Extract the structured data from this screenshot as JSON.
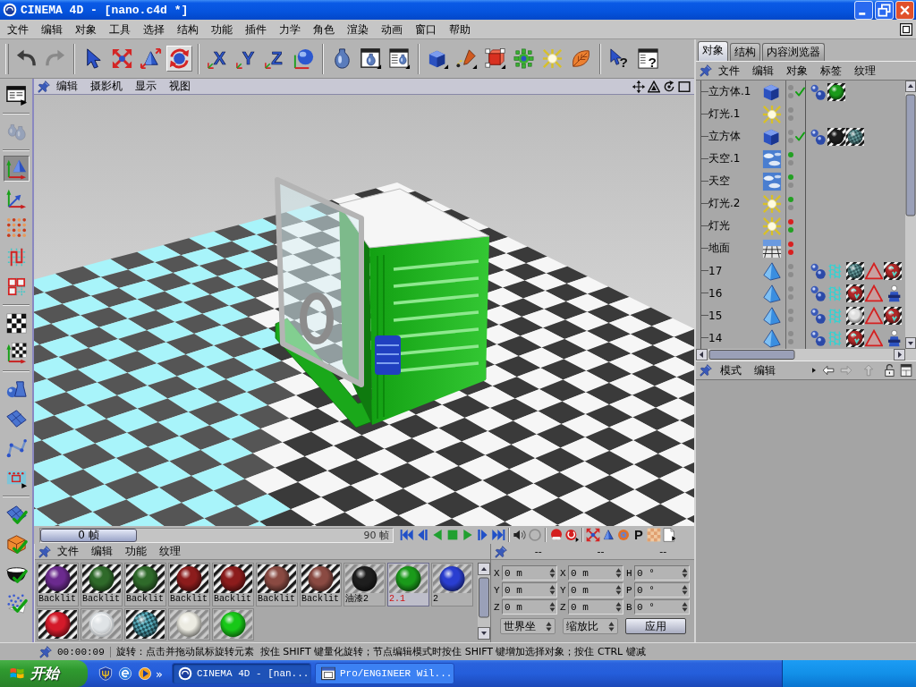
{
  "window": {
    "title": "CINEMA 4D - [nano.c4d *]"
  },
  "menu_bar": [
    "文件",
    "编辑",
    "对象",
    "工具",
    "选择",
    "结构",
    "功能",
    "插件",
    "力学",
    "角色",
    "渲染",
    "动画",
    "窗口",
    "帮助"
  ],
  "toolbar": [
    [
      {
        "kind": "undo",
        "selected": false,
        "disabled": false
      },
      {
        "kind": "redo",
        "selected": false,
        "disabled": true
      }
    ],
    [
      {
        "kind": "select",
        "selected": false,
        "disabled": false
      },
      {
        "kind": "move",
        "selected": false,
        "disabled": false
      },
      {
        "kind": "scale",
        "selected": false,
        "disabled": false
      },
      {
        "kind": "rotate",
        "selected": true,
        "disabled": false
      }
    ],
    [
      {
        "kind": "axis",
        "label": "X",
        "selected": false,
        "disabled": false
      },
      {
        "kind": "axis",
        "label": "Y",
        "selected": false,
        "disabled": false
      },
      {
        "kind": "axis",
        "label": "Z",
        "selected": false,
        "disabled": false
      },
      {
        "kind": "world",
        "selected": false,
        "disabled": false
      }
    ],
    [
      {
        "kind": "render-view",
        "selected": false,
        "disabled": false
      },
      {
        "kind": "render-picture",
        "selected": false,
        "disabled": false
      },
      {
        "kind": "render-settings",
        "selected": false,
        "disabled": false
      }
    ],
    [
      {
        "kind": "cube",
        "selected": false,
        "disabled": false
      },
      {
        "kind": "spline",
        "selected": false,
        "disabled": false
      },
      {
        "kind": "nurbs",
        "selected": false,
        "disabled": false
      },
      {
        "kind": "array",
        "selected": false,
        "disabled": false
      },
      {
        "kind": "light",
        "selected": false,
        "disabled": false
      },
      {
        "kind": "deformer",
        "selected": false,
        "disabled": false
      }
    ],
    [
      {
        "kind": "help-arrow",
        "label": "?",
        "selected": false,
        "disabled": false
      },
      {
        "kind": "help-window",
        "label": "?",
        "selected": false,
        "disabled": false
      }
    ]
  ],
  "left_toolbar": [
    [
      {
        "kind": "layout",
        "selected": false,
        "disabled": false
      }
    ],
    [
      {
        "kind": "vases",
        "selected": false,
        "disabled": true
      }
    ],
    [
      {
        "kind": "model-tool",
        "selected": true,
        "disabled": false
      },
      {
        "kind": "object-axis",
        "selected": false,
        "disabled": false
      },
      {
        "kind": "points",
        "selected": false,
        "disabled": false
      },
      {
        "kind": "edges",
        "selected": false,
        "disabled": false
      },
      {
        "kind": "polygons",
        "selected": false,
        "disabled": false
      }
    ],
    [
      {
        "kind": "texture",
        "selected": false,
        "disabled": false
      },
      {
        "kind": "texture-axis",
        "selected": false,
        "disabled": false
      }
    ],
    [
      {
        "kind": "shapes",
        "selected": false,
        "disabled": false
      },
      {
        "kind": "plane",
        "selected": false,
        "disabled": false
      },
      {
        "kind": "bones",
        "selected": false,
        "disabled": false
      },
      {
        "kind": "animation",
        "selected": false,
        "disabled": false
      }
    ],
    [
      {
        "kind": "plane",
        "selected": false,
        "disabled": false,
        "checked": true
      },
      {
        "kind": "box",
        "selected": false,
        "disabled": false,
        "checked": true
      },
      {
        "kind": "bowl",
        "selected": false,
        "disabled": false,
        "checked": true
      },
      {
        "kind": "particles",
        "selected": false,
        "disabled": false,
        "checked": true
      }
    ]
  ],
  "viewport": {
    "menu": [
      "编辑",
      "摄影机",
      "显示",
      "视图"
    ]
  },
  "timeline": {
    "current": "0 帧",
    "level": 0,
    "end": "90 帧",
    "parameter_key": "P"
  },
  "material_manager": {
    "menu": [
      "文件",
      "编辑",
      "功能",
      "纹理"
    ],
    "materials": [
      {
        "name": "Backlit",
        "color": "#6b2a8e",
        "kind": "solid",
        "dark_backdrop": true,
        "selected": false
      },
      {
        "name": "Backlit",
        "color": "#2f6a2a",
        "kind": "solid",
        "dark_backdrop": true,
        "selected": false
      },
      {
        "name": "Backlit",
        "color": "#2f6a2a",
        "kind": "solid",
        "dark_backdrop": true,
        "selected": false
      },
      {
        "name": "Backlit",
        "color": "#8c1c1c",
        "kind": "solid",
        "dark_backdrop": true,
        "selected": false
      },
      {
        "name": "Backlit",
        "color": "#8c1c1c",
        "kind": "solid",
        "dark_backdrop": true,
        "selected": false
      },
      {
        "name": "Backlit",
        "color": "#8a4a42",
        "kind": "solid",
        "dark_backdrop": true,
        "selected": false
      },
      {
        "name": "Backlit",
        "color": "#8a4a42",
        "kind": "solid",
        "dark_backdrop": true,
        "selected": false
      },
      {
        "name": "油漆2",
        "color": "#1e1e1e",
        "kind": "solid",
        "dark_backdrop": false,
        "selected": false
      },
      {
        "name": "2.1",
        "color": "#1a9a1a",
        "kind": "solid",
        "dark_backdrop": false,
        "selected": true
      },
      {
        "name": "2",
        "color": "#2a3ed0",
        "kind": "solid",
        "dark_backdrop": false,
        "selected": false
      },
      {
        "color": "#d41a2a",
        "kind": "solid",
        "dark_backdrop": true,
        "selected": false
      },
      {
        "color": "#dfe3e6",
        "kind": "glass",
        "dark_backdrop": false,
        "selected": false
      },
      {
        "color": "#5ab0c0",
        "kind": "checker",
        "dark_backdrop": true,
        "selected": false
      },
      {
        "color": "#ecebe2",
        "kind": "solid",
        "dark_backdrop": false,
        "selected": false
      },
      {
        "color": "#18c818",
        "kind": "solid",
        "dark_backdrop": false,
        "selected": false
      }
    ]
  },
  "coordinates": {
    "headers": [
      "--",
      "--",
      "--"
    ],
    "rows": [
      [
        {
          "axis": "X",
          "value": "0 m"
        },
        {
          "axis": "X",
          "value": "0 m"
        },
        {
          "axis": "H",
          "value": "0 °"
        }
      ],
      [
        {
          "axis": "Y",
          "value": "0 m"
        },
        {
          "axis": "Y",
          "value": "0 m"
        },
        {
          "axis": "P",
          "value": "0 °"
        }
      ],
      [
        {
          "axis": "Z",
          "value": "0 m"
        },
        {
          "axis": "Z",
          "value": "0 m"
        },
        {
          "axis": "B",
          "value": "0 °"
        }
      ]
    ],
    "dropdowns": [
      "世界坐",
      "缩放比"
    ],
    "apply": "应用"
  },
  "object_manager": {
    "tabs": [
      {
        "label": "对象",
        "selected": true
      },
      {
        "label": "结构",
        "selected": false
      },
      {
        "label": "内容浏览器",
        "selected": false
      }
    ],
    "menu": [
      "文件",
      "编辑",
      "对象",
      "标签",
      "纹理"
    ],
    "objects": [
      {
        "name": "立方体.1",
        "kind": "cube",
        "dots": [
          {
            "color": "#8c8c8c"
          },
          {
            "color": "#8c8c8c"
          }
        ],
        "checked": true,
        "tags": [
          {
            "kind": "phong"
          },
          {
            "kind": "material",
            "color": "#1a9a1a"
          }
        ]
      },
      {
        "name": "灯光.1",
        "kind": "light",
        "dots": [
          {
            "color": "#8c8c8c"
          },
          {
            "color": "#8c8c8c"
          }
        ],
        "checked": false
      },
      {
        "name": "立方体",
        "kind": "cube",
        "dots": [
          {
            "color": "#8c8c8c"
          },
          {
            "color": "#8c8c8c"
          }
        ],
        "checked": true,
        "tags": [
          {
            "kind": "phong"
          },
          {
            "kind": "material",
            "color": "#1e1e1e"
          },
          {
            "kind": "checker-material",
            "color": "#6aa0a0"
          }
        ]
      },
      {
        "name": "天空.1",
        "kind": "sky",
        "dots": [
          {
            "color": "#22a022"
          },
          {
            "color": "#8c8c8c"
          }
        ],
        "checked": false
      },
      {
        "name": "天空",
        "kind": "sky",
        "dots": [
          {
            "color": "#22a022"
          },
          {
            "color": "#8c8c8c"
          }
        ],
        "checked": false
      },
      {
        "name": "灯光.2",
        "kind": "light",
        "dots": [
          {
            "color": "#22a022"
          },
          {
            "color": "#8c8c8c"
          }
        ],
        "checked": false
      },
      {
        "name": "灯光",
        "kind": "light",
        "dots": [
          {
            "color": "#d82020"
          },
          {
            "color": "#22a022"
          }
        ],
        "checked": false
      },
      {
        "name": "地面",
        "kind": "floor",
        "dots": [
          {
            "color": "#d82020"
          },
          {
            "color": "#d82020"
          }
        ],
        "checked": false
      },
      {
        "name": "17",
        "kind": "polygon",
        "dots": [
          {
            "color": "#8c8c8c"
          },
          {
            "color": "#8c8c8c"
          }
        ],
        "checked": false,
        "tags": [
          {
            "kind": "phong"
          },
          {
            "kind": "uvw"
          },
          {
            "kind": "checker-material",
            "color": "#6aa0a0"
          },
          {
            "kind": "selection"
          },
          {
            "kind": "texture-material",
            "color": "#b02828"
          }
        ]
      },
      {
        "name": "16",
        "kind": "polygon",
        "dots": [
          {
            "color": "#8c8c8c"
          },
          {
            "color": "#8c8c8c"
          }
        ],
        "checked": false,
        "tags": [
          {
            "kind": "phong"
          },
          {
            "kind": "uvw"
          },
          {
            "kind": "texture-material",
            "color": "#b02828"
          },
          {
            "kind": "selection"
          },
          {
            "kind": "display"
          }
        ]
      },
      {
        "name": "15",
        "kind": "polygon",
        "dots": [
          {
            "color": "#8c8c8c"
          },
          {
            "color": "#8c8c8c"
          }
        ],
        "checked": false,
        "tags": [
          {
            "kind": "phong"
          },
          {
            "kind": "uvw"
          },
          {
            "kind": "material",
            "color": "#e0e0e0"
          },
          {
            "kind": "selection"
          },
          {
            "kind": "texture-material",
            "color": "#b02828"
          }
        ]
      },
      {
        "name": "14",
        "kind": "polygon",
        "dots": [
          {
            "color": "#8c8c8c"
          },
          {
            "color": "#8c8c8c"
          }
        ],
        "checked": false,
        "tags": [
          {
            "kind": "phong"
          },
          {
            "kind": "uvw"
          },
          {
            "kind": "texture-material",
            "color": "#b02828"
          },
          {
            "kind": "selection"
          },
          {
            "kind": "display"
          }
        ]
      }
    ]
  },
  "attribute_manager": {
    "menu": [
      "模式",
      "编辑"
    ]
  },
  "status_bar": {
    "time": "00:00:09",
    "message": "旋转：点击并拖动鼠标旋转元素  按住 SHIFT 键量化旋转；节点编辑模式时按住 SHIFT 键增加选择对象；按住 CTRL 键减"
  },
  "taskbar": {
    "start": "开始",
    "overflow": "»",
    "tasks": [
      {
        "label": "CINEMA 4D - [nan...",
        "kind": "sphere-app",
        "selected": true
      },
      {
        "label": "Pro/ENGINEER Wil...",
        "kind": "window-app",
        "selected": false
      }
    ]
  }
}
